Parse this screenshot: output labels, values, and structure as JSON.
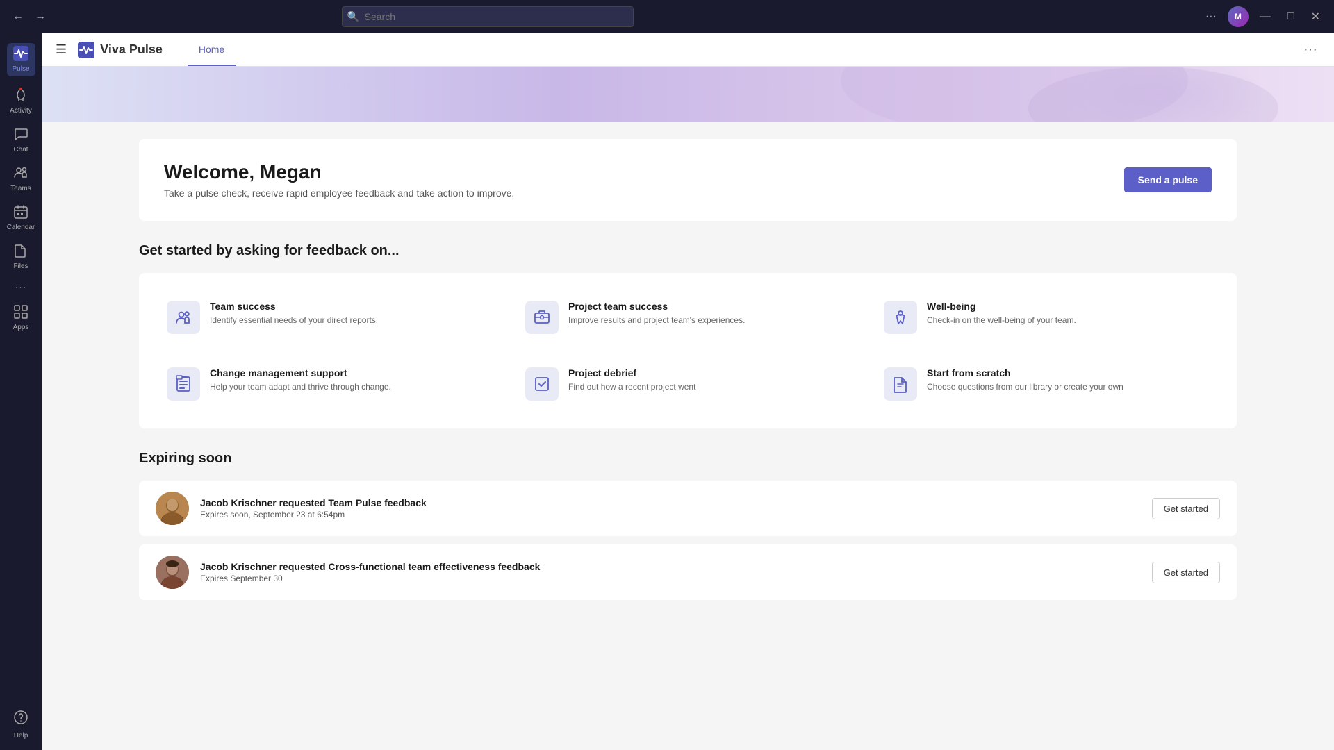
{
  "titlebar": {
    "nav_back": "←",
    "nav_forward": "→",
    "nav_refresh": "↺",
    "search_placeholder": "Search",
    "more_label": "···",
    "minimize": "—",
    "maximize": "□",
    "close": "✕"
  },
  "sidebar": {
    "items": [
      {
        "id": "pulse",
        "label": "Pulse",
        "icon": "⚡",
        "active": true
      },
      {
        "id": "activity",
        "label": "Activity",
        "icon": "🔔",
        "active": false
      },
      {
        "id": "chat",
        "label": "Chat",
        "icon": "💬",
        "active": false
      },
      {
        "id": "teams",
        "label": "Teams",
        "icon": "👥",
        "active": false
      },
      {
        "id": "calendar",
        "label": "Calendar",
        "icon": "📅",
        "active": false
      },
      {
        "id": "files",
        "label": "Files",
        "icon": "📄",
        "active": false
      },
      {
        "id": "more",
        "label": "···",
        "icon": "···",
        "active": false
      },
      {
        "id": "apps",
        "label": "Apps",
        "icon": "⊞",
        "active": false
      }
    ],
    "bottom": [
      {
        "id": "help",
        "label": "Help",
        "icon": "❓"
      }
    ]
  },
  "header": {
    "menu_label": "☰",
    "app_name": "Viva  Pulse",
    "nav_items": [
      {
        "id": "home",
        "label": "Home",
        "active": true
      }
    ],
    "more_btn": "···"
  },
  "welcome": {
    "greeting": "Welcome, Megan",
    "subtitle": "Take a pulse check, receive rapid employee feedback and take action to improve.",
    "cta_button": "Send a pulse"
  },
  "feedback_section": {
    "title": "Get started by asking for feedback on...",
    "cards": [
      {
        "id": "team-success",
        "title": "Team success",
        "description": "Identify essential needs of your direct reports.",
        "icon": "👥"
      },
      {
        "id": "project-team-success",
        "title": "Project team success",
        "description": "Improve results and project team's experiences.",
        "icon": "💼"
      },
      {
        "id": "well-being",
        "title": "Well-being",
        "description": "Check-in on the well-being of your team.",
        "icon": "🏃"
      },
      {
        "id": "change-management",
        "title": "Change management support",
        "description": "Help your team adapt and thrive through change.",
        "icon": "📋"
      },
      {
        "id": "project-debrief",
        "title": "Project debrief",
        "description": "Find out how a recent project went",
        "icon": "✅"
      },
      {
        "id": "start-scratch",
        "title": "Start from scratch",
        "description": "Choose questions from our library or create your own",
        "icon": "📝"
      }
    ]
  },
  "expiring_section": {
    "title": "Expiring soon",
    "items": [
      {
        "id": "item-1",
        "requester": "Jacob Krischner",
        "request_text": "Jacob Krischner requested Team Pulse feedback",
        "expiry": "Expires soon, September 23 at 6:54pm",
        "cta": "Get started"
      },
      {
        "id": "item-2",
        "requester": "Jacob Krischner",
        "request_text": "Jacob Krischner requested Cross-functional team effectiveness feedback",
        "expiry": "Expires September 30",
        "cta": "Get started"
      }
    ]
  },
  "colors": {
    "accent": "#5b5fc7",
    "sidebar_bg": "#1a1a2e",
    "card_bg": "#e8eaf6"
  }
}
